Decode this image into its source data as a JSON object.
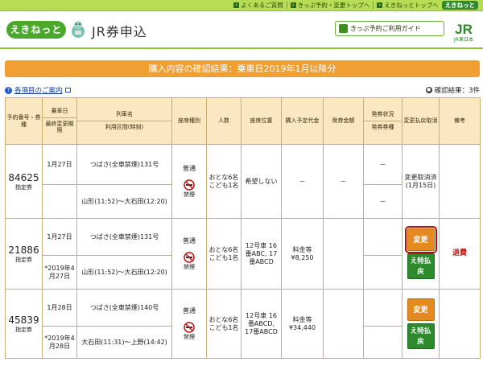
{
  "toplinks": {
    "faq": "よくあるご質問",
    "kippu_top": "きっぷ予約・変更トップへ",
    "ekinet_top": "えきねっとトップへ",
    "ekinet_btn": "えきねっと"
  },
  "header": {
    "logo": "えきねっと",
    "title": "JR券申込",
    "guide": "きっぷ予約ご利用ガイド",
    "jr_small": "JR東日本"
  },
  "banner": "購入内容の確認結果：乗車日2019年1月以降分",
  "help_link": "各項目のご案内",
  "result_label": "確認結果：3件",
  "columns": {
    "rsv_no": "予約番号・券種",
    "ride_date": "乗車日",
    "final_change": "最終変更期限",
    "train_name": "列車名",
    "section": "利用区間(時刻)",
    "seat_type": "座席種別",
    "people": "人数",
    "seat_pos": "座席位置",
    "planned_fare": "購入予定代金",
    "issued_amount": "発券金額",
    "issue_status": "発券状況",
    "issue_type": "発券券種",
    "change_refund": "変更払戻取消",
    "remarks": "備考"
  },
  "rows": [
    {
      "rsv_no": "84625",
      "ticket": "指定券",
      "date1": "1月27日",
      "date2": "",
      "train1": "つばさ(全車禁煙)131号",
      "section1": "山形(11:52)〜大石田(12:20)",
      "seat": "普通",
      "smoke": "禁煙",
      "people": "おとな6名こども1名",
      "position": "希望しない",
      "fare": "－",
      "issued": "－",
      "status1": "－",
      "status2": "－",
      "action_text": "変更取消済(1月15日)"
    },
    {
      "rsv_no": "21886",
      "ticket": "指定券",
      "date1": "1月27日",
      "date2": "*2019年4月27日",
      "train1": "つばさ(全車禁煙)131号",
      "section1": "山形(11:52)〜大石田(12:20)",
      "seat": "普通",
      "smoke": "禁煙",
      "people": "おとな6名こども1名",
      "position": "12号車 16番ABC, 17番ABCD",
      "fare": "料金等 ¥8,250",
      "issued": "",
      "btn_change": "変更",
      "btn_refund": "え特払戻",
      "remark": "退費"
    },
    {
      "rsv_no": "45839",
      "ticket": "指定券",
      "date1": "1月28日",
      "date2": "*2019年4月28日",
      "train1": "つばさ(全車禁煙)140号",
      "section1": "大石田(11:31)〜上野(14:42)",
      "seat": "普通",
      "smoke": "禁煙",
      "people": "おとな6名こども1名",
      "position": "12号車 16番ABCD, 17番ABCD",
      "fare": "料金等 ¥34,440",
      "issued": "",
      "btn_change": "変更",
      "btn_refund": "え特払戻"
    }
  ]
}
